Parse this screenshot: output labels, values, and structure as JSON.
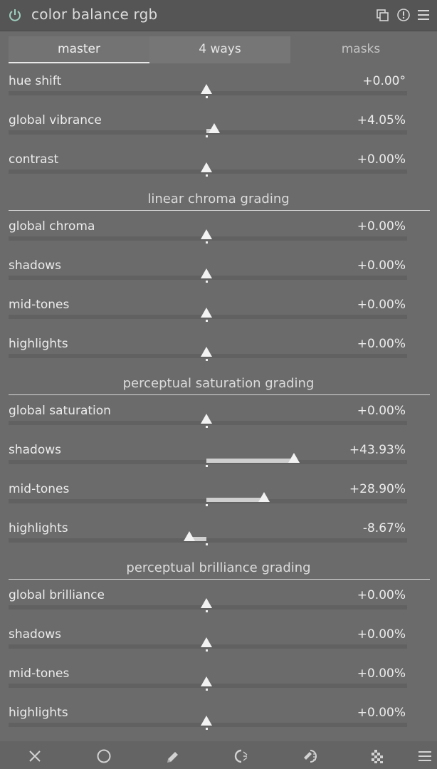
{
  "header": {
    "title": "color balance rgb",
    "icons": [
      "power-icon",
      "multi-instance-icon",
      "reset-icon",
      "presets-menu-icon"
    ]
  },
  "tabs": [
    {
      "label": "master",
      "active": true
    },
    {
      "label": "4 ways",
      "active": false
    },
    {
      "label": "masks",
      "active": false
    }
  ],
  "groups": {
    "top": [
      {
        "label": "hue shift",
        "value": "+0.00°",
        "fraction": 0.0
      },
      {
        "label": "global vibrance",
        "value": "+4.05%",
        "fraction": 0.0405
      },
      {
        "label": "contrast",
        "value": "+0.00%",
        "fraction": 0.0
      }
    ],
    "linear_chroma": {
      "title": "linear chroma grading",
      "rows": [
        {
          "label": "global chroma",
          "value": "+0.00%",
          "fraction": 0.0
        },
        {
          "label": "shadows",
          "value": "+0.00%",
          "fraction": 0.0
        },
        {
          "label": "mid-tones",
          "value": "+0.00%",
          "fraction": 0.0
        },
        {
          "label": "highlights",
          "value": "+0.00%",
          "fraction": 0.0
        }
      ]
    },
    "perceptual_saturation": {
      "title": "perceptual saturation grading",
      "rows": [
        {
          "label": "global saturation",
          "value": "+0.00%",
          "fraction": 0.0
        },
        {
          "label": "shadows",
          "value": "+43.93%",
          "fraction": 0.4393
        },
        {
          "label": "mid-tones",
          "value": "+28.90%",
          "fraction": 0.289
        },
        {
          "label": "highlights",
          "value": "-8.67%",
          "fraction": -0.0867
        }
      ]
    },
    "perceptual_brilliance": {
      "title": "perceptual brilliance grading",
      "rows": [
        {
          "label": "global brilliance",
          "value": "+0.00%",
          "fraction": 0.0
        },
        {
          "label": "shadows",
          "value": "+0.00%",
          "fraction": 0.0
        },
        {
          "label": "mid-tones",
          "value": "+0.00%",
          "fraction": 0.0
        },
        {
          "label": "highlights",
          "value": "+0.00%",
          "fraction": 0.0
        }
      ]
    }
  },
  "bottom_toolbar": {
    "icons": [
      "mask-off-icon",
      "uniform-mask-icon",
      "drawn-mask-icon",
      "parametric-mask-icon",
      "drawn-parametric-mask-icon",
      "raster-mask-icon",
      "blend-menu-icon"
    ]
  },
  "colors": {
    "panel_bg": "#6b6b6b",
    "header_bg": "#555555",
    "text": "#ececec",
    "power_on": "#9fd0c0"
  }
}
